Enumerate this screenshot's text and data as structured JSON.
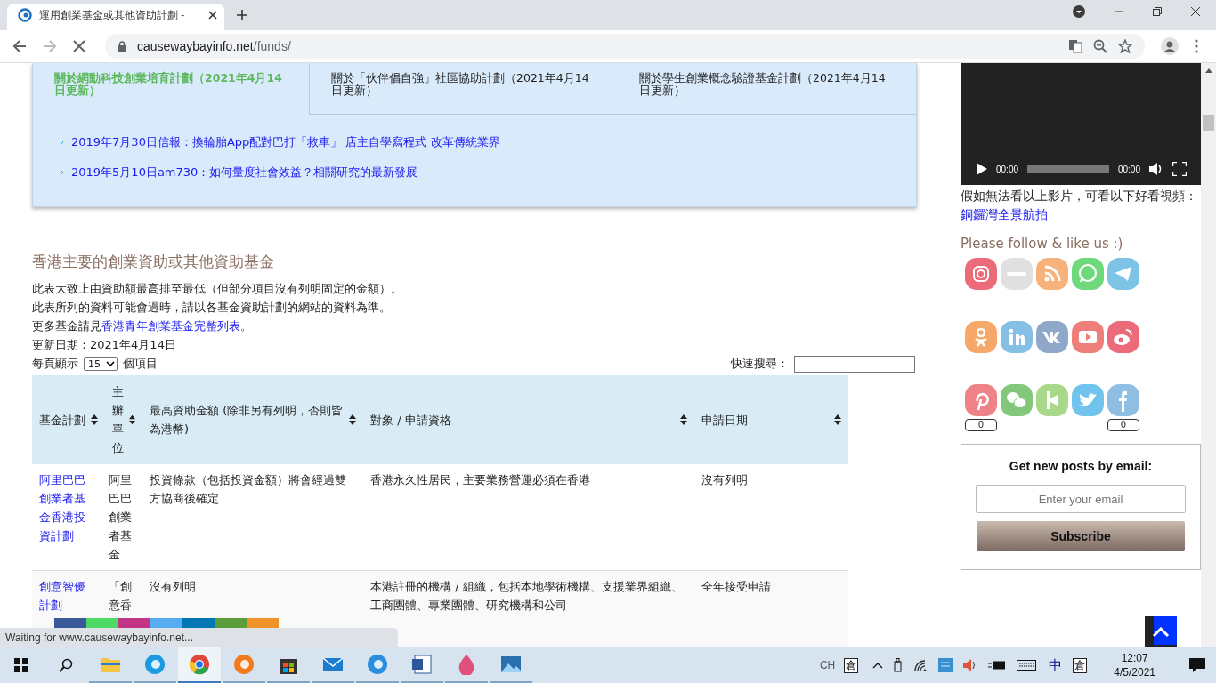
{
  "browser": {
    "tab_title": "運用創業基金或其他資助計劃 -",
    "url_host": "causewaybayinfo.net",
    "url_path": "/funds/",
    "status": "Waiting for www.causewaybayinfo.net..."
  },
  "fund_tabs": [
    {
      "label": "關於網動科技創業培育計劃（2021年4月14日更新）",
      "selected": true
    },
    {
      "label": "關於「伙伴倡自強」社區協助計劃（2021年4月14日更新）",
      "selected": false
    },
    {
      "label": "關於學生創業概念驗證基金計劃（2021年4月14日更新）",
      "selected": false
    }
  ],
  "news_links": [
    "2019年7月30日信報：換輪胎App配對巴打「救車」 店主自學寫程式 改革傳統業界",
    "2019年5月10日am730：如何量度社會效益？相關研究的最新發展"
  ],
  "section": {
    "heading": "香港主要的創業資助或其他資助基金",
    "lines": [
      "此表大致上由資助額最高排至最低（但部分項目沒有列明固定的金額）。",
      "此表所列的資料可能會過時，請以各基金資助計劃的網站的資料為準。"
    ],
    "more": {
      "before": "更多基金請見",
      "link": "香港青年創業基金完整列表",
      "after": "。"
    },
    "updated": "更新日期：2021年4月14日"
  },
  "page_size": {
    "before": "每頁顯示",
    "value": "15",
    "after": "個項目"
  },
  "search": {
    "label": "快速搜尋："
  },
  "table": {
    "columns": [
      "基金計劃",
      "主辦單位",
      "最高資助金額 (除非另有列明，否則皆為港幣)",
      "對象 / 申請資格",
      "申請日期"
    ],
    "rows": [
      {
        "cells": [
          "阿里巴巴創業者基金香港投資計劃",
          "阿里巴巴創業者基金",
          "投資條款（包括投資金額）將會經過雙方協商後確定",
          "香港永久性居民，主要業務營運必須在香港",
          "沒有列明"
        ]
      },
      {
        "cells": [
          "創意智優計劃",
          "「創意香",
          "沒有列明",
          "本港註冊的機構 / 組織，包括本地學術機構、支援業界組織、工商團體、專業團體、研究機構和公司",
          "全年接受申請"
        ]
      }
    ]
  },
  "share_bar": [
    {
      "color": "#3b5998"
    },
    {
      "color": "#4cd964"
    },
    {
      "color": "#c13584"
    },
    {
      "color": "#55acee"
    },
    {
      "color": "#0077b5"
    },
    {
      "color": "#5d9c3a"
    },
    {
      "color": "#f0932b"
    }
  ],
  "sidebar": {
    "video": {
      "elapsed": "00:00",
      "duration": "00:00"
    },
    "note": "假如無法看以上影片，可看以下好看視頻：",
    "note_link": "銅鑼灣全景航拍",
    "follow_title": "Please follow & like us :)",
    "socials": [
      {
        "kind": "instagram",
        "color": "#ec6b7a"
      },
      {
        "kind": "follow",
        "color": "#e0e0e0"
      },
      {
        "kind": "rss",
        "color": "#f6b27a"
      },
      {
        "kind": "whatsapp",
        "color": "#6dd97a"
      },
      {
        "kind": "telegram",
        "color": "#7cc3e6"
      },
      {
        "kind": "ok",
        "color": "#f5a86a"
      },
      {
        "kind": "linkedin",
        "color": "#86bfe6"
      },
      {
        "kind": "vk",
        "color": "#8fa8c9"
      },
      {
        "kind": "youtube",
        "color": "#ee7e7a"
      },
      {
        "kind": "weibo",
        "color": "#ec6b7a"
      },
      {
        "kind": "pinterest",
        "color": "#ee8286",
        "count": "0"
      },
      {
        "kind": "wechat",
        "color": "#82c77a"
      },
      {
        "kind": "houzz",
        "color": "#a8d88a"
      },
      {
        "kind": "twitter",
        "color": "#6fc3ec"
      },
      {
        "kind": "facebook",
        "color": "#8ebfe2",
        "count": "0"
      }
    ],
    "email": {
      "title": "Get new posts by email:",
      "placeholder": "Enter your email",
      "button": "Subscribe"
    }
  },
  "taskbar": {
    "apps": [
      {
        "kind": "files",
        "selected": false
      },
      {
        "kind": "edge",
        "selected": false
      },
      {
        "kind": "chrome",
        "selected": true
      },
      {
        "kind": "firefox",
        "selected": false
      },
      {
        "kind": "store",
        "selected": false
      },
      {
        "kind": "mail",
        "selected": false
      },
      {
        "kind": "ie",
        "selected": false
      },
      {
        "kind": "word",
        "selected": false
      },
      {
        "kind": "drop",
        "selected": false
      },
      {
        "kind": "photos",
        "selected": false
      }
    ],
    "ime_mode": "CH",
    "ime_icon": "倉",
    "lang": "中",
    "ime_icon_2": "倉",
    "time": "12:07",
    "date": "4/5/2021"
  }
}
